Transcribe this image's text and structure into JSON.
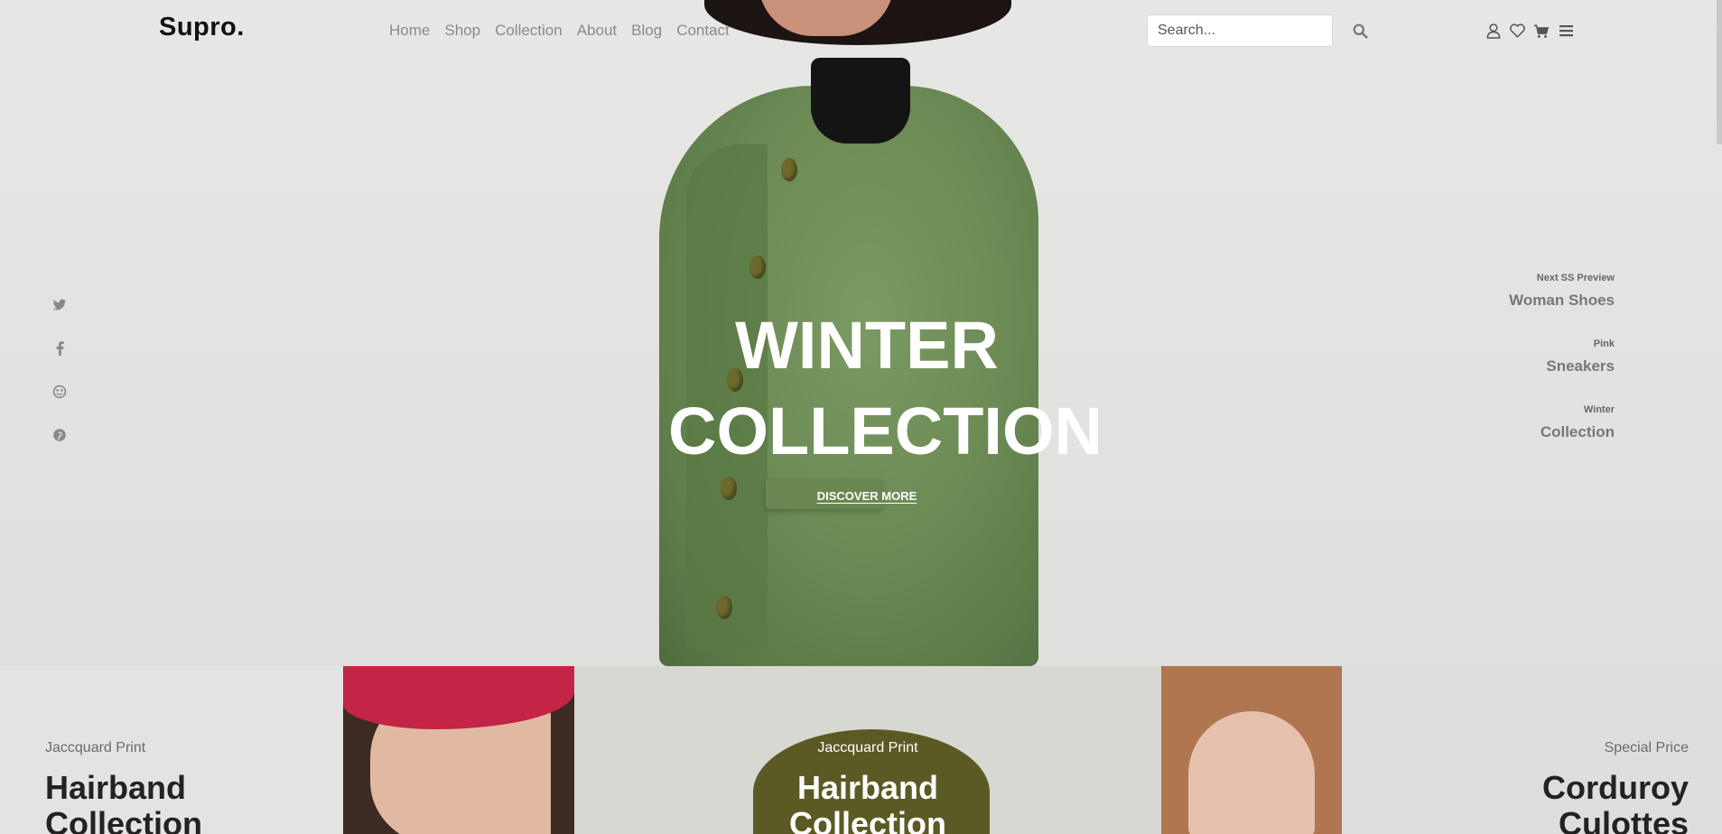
{
  "header": {
    "logo": "Supro.",
    "nav": [
      "Home",
      "Shop",
      "Collection",
      "About",
      "Blog",
      "Contact"
    ],
    "search_placeholder": "Search..."
  },
  "icons": {
    "search": "search-icon",
    "user": "user-icon",
    "wishlist": "heart-icon",
    "cart": "cart-icon",
    "menu": "menu-icon",
    "social": [
      "twitter-icon",
      "facebook-icon",
      "dribbble-icon",
      "pinterest-icon"
    ]
  },
  "hero": {
    "title_line1": "WINTER",
    "title_line2": "COLLECTION",
    "cta": "DISCOVER MORE"
  },
  "slides": [
    {
      "kicker": "Next SS Preview",
      "name": "Woman Shoes"
    },
    {
      "kicker": "Pink",
      "name": "Sneakers"
    },
    {
      "kicker": "Winter",
      "name": "Collection"
    }
  ],
  "banners": [
    {
      "kicker": "Jaccquard Print",
      "title_line1": "Hairband",
      "title_line2": "Collection"
    },
    {
      "kicker": "Jaccquard Print",
      "title_line1": "Hairband",
      "title_line2": "Collection"
    },
    {
      "kicker": "Special Price",
      "title_line1": "Corduroy",
      "title_line2": "Culottes"
    }
  ],
  "colors": {
    "hero_bg": "#e4e4e2",
    "coat_green": "#6c8b55",
    "text_dark": "#222222",
    "nav_grey": "#8a8a8a"
  }
}
